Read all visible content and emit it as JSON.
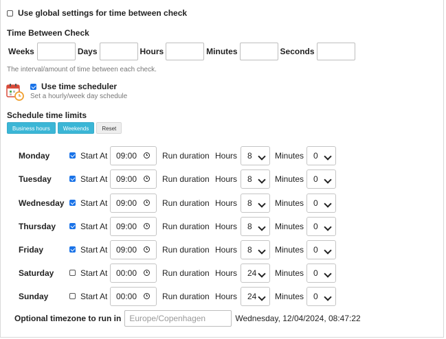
{
  "global_settings": {
    "label": "Use global settings for time between check",
    "checked": false
  },
  "time_between_check": {
    "title": "Time Between Check",
    "fields": [
      {
        "label": "Weeks",
        "value": ""
      },
      {
        "label": "Days",
        "value": ""
      },
      {
        "label": "Hours",
        "value": ""
      },
      {
        "label": "Minutes",
        "value": ""
      },
      {
        "label": "Seconds",
        "value": ""
      }
    ],
    "help": "The interval/amount of time between each check."
  },
  "scheduler": {
    "label": "Use time scheduler",
    "checked": true,
    "help": "Set a hourly/week day schedule",
    "icon": "calendar-clock-icon"
  },
  "schedule_limits": {
    "title": "Schedule time limits",
    "buttons": {
      "business": "Business hours",
      "weekends": "Weekends",
      "reset": "Reset"
    }
  },
  "labels": {
    "start_at": "Start At",
    "run_duration": "Run duration",
    "hours": "Hours",
    "minutes": "Minutes"
  },
  "days": [
    {
      "name": "Monday",
      "enabled": true,
      "start": "09:00",
      "hours": "8",
      "minutes": "0"
    },
    {
      "name": "Tuesday",
      "enabled": true,
      "start": "09:00",
      "hours": "8",
      "minutes": "0"
    },
    {
      "name": "Wednesday",
      "enabled": true,
      "start": "09:00",
      "hours": "8",
      "minutes": "0"
    },
    {
      "name": "Thursday",
      "enabled": true,
      "start": "09:00",
      "hours": "8",
      "minutes": "0"
    },
    {
      "name": "Friday",
      "enabled": true,
      "start": "09:00",
      "hours": "8",
      "minutes": "0"
    },
    {
      "name": "Saturday",
      "enabled": false,
      "start": "00:00",
      "hours": "24",
      "minutes": "0"
    },
    {
      "name": "Sunday",
      "enabled": false,
      "start": "00:00",
      "hours": "24",
      "minutes": "0"
    }
  ],
  "timezone": {
    "label": "Optional timezone to run in",
    "placeholder": "Europe/Copenhagen",
    "current_time": "Wednesday, 12/04/2024, 08:47:22"
  },
  "colors": {
    "accent": "#3bb6d6",
    "checkbox": "#1a73e8"
  }
}
